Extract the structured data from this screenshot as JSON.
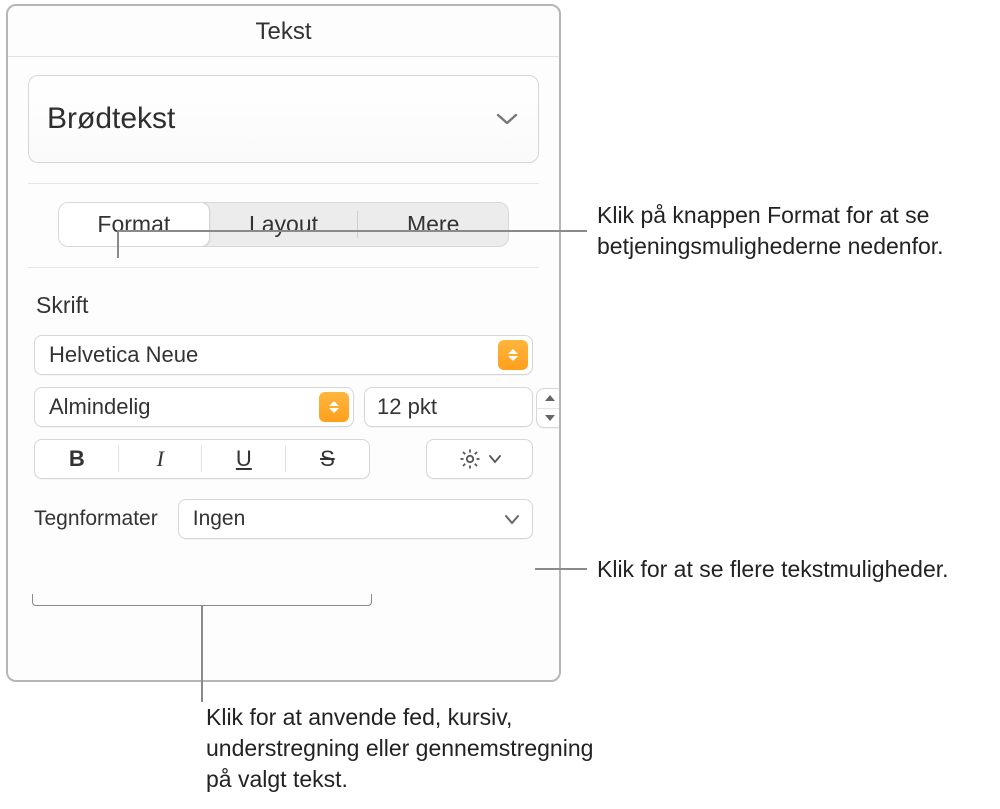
{
  "panel": {
    "title": "Tekst",
    "paragraph_style": "Brødtekst",
    "tabs": {
      "format": "Format",
      "layout": "Layout",
      "more": "Mere"
    },
    "font_section_label": "Skrift",
    "font_family": "Helvetica Neue",
    "font_variant": "Almindelig",
    "font_size": "12 pkt",
    "style_letters": {
      "bold": "B",
      "italic": "I",
      "underline": "U",
      "strike": "S"
    },
    "char_formats_label": "Tegnformater",
    "char_formats_value": "Ingen"
  },
  "callouts": {
    "format_button": "Klik på knappen Format for at se betjeningsmulighederne nedenfor.",
    "gear_button": "Klik for at se flere tekstmuligheder.",
    "bius": "Klik for at anvende fed, kursiv, understregning eller gennemstregning på valgt tekst."
  }
}
